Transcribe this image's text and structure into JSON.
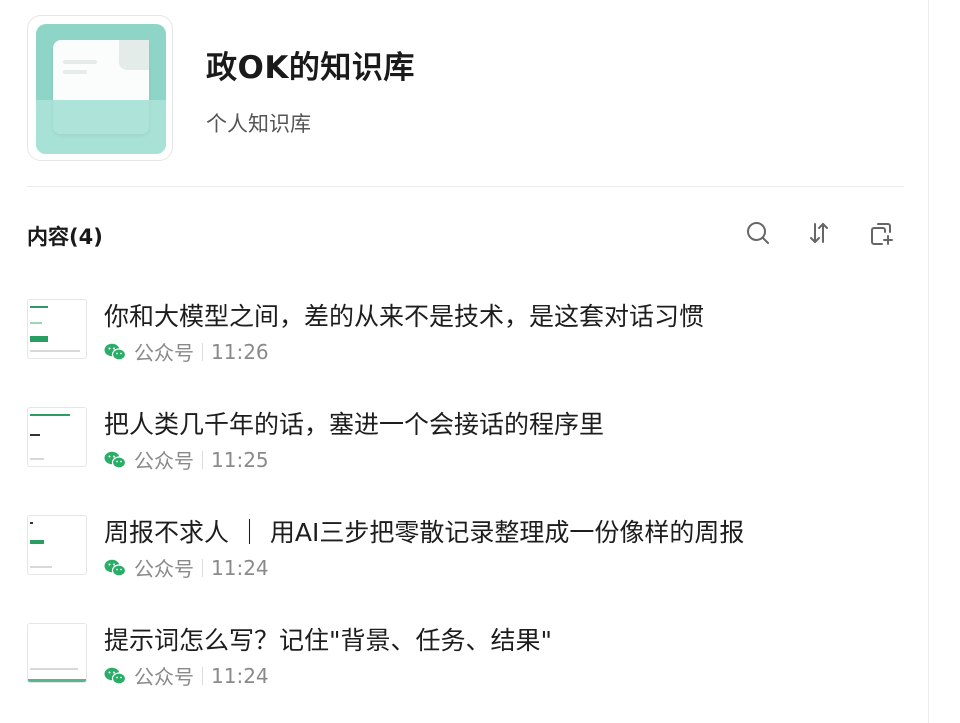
{
  "knowledge_base": {
    "title": "政OK的知识库",
    "subtitle": "个人知识库",
    "cover_icon": "document-folder-icon",
    "accent_color": "#8fd5c7"
  },
  "content": {
    "heading": "内容(4)",
    "toolbar": {
      "search_icon": "search-icon",
      "sort_icon": "sort-icon",
      "add_icon": "add-document-icon"
    },
    "items": [
      {
        "title": "你和大模型之间，差的从来不是技术，是这套对话习惯",
        "source": "公众号",
        "time": "11:26"
      },
      {
        "title": "把人类几千年的话，塞进一个会接话的程序里",
        "source": "公众号",
        "time": "11:25"
      },
      {
        "title": "周报不求人 ｜ 用AI三步把零散记录整理成一份像样的周报",
        "source": "公众号",
        "time": "11:24"
      },
      {
        "title": "提示词怎么写？记住\"背景、任务、结果\"",
        "source": "公众号",
        "time": "11:24"
      }
    ]
  },
  "colors": {
    "wechat_green": "#2aae67",
    "muted_text": "#8a8a8a"
  }
}
